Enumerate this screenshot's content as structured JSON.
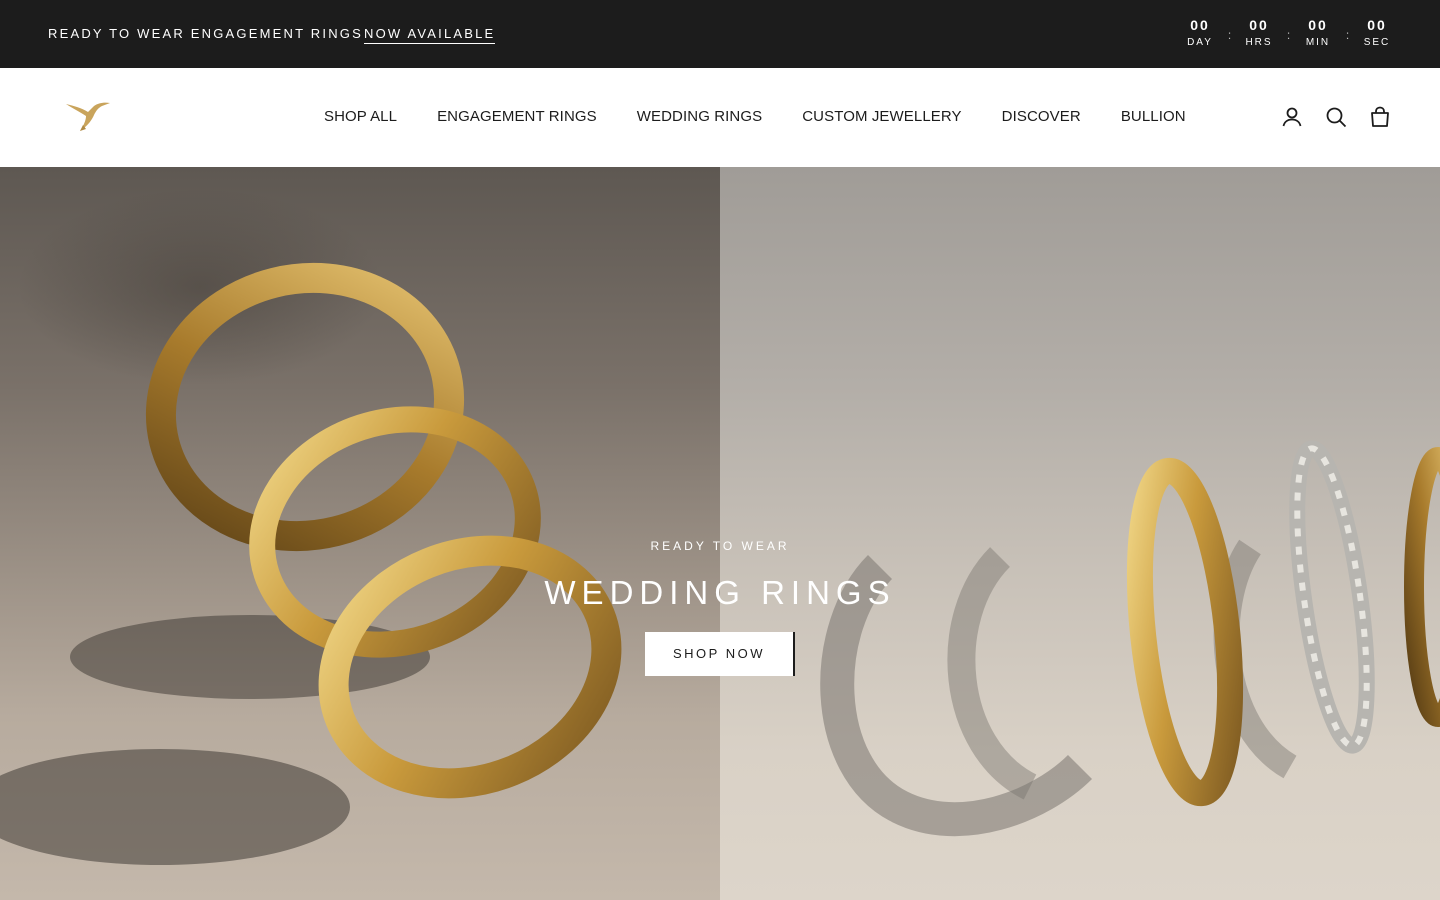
{
  "announcement": {
    "text": "READY TO WEAR ENGAGEMENT RINGS",
    "link_label": "NOW AVAILABLE",
    "countdown": [
      {
        "value": "00",
        "label": "DAY"
      },
      {
        "value": "00",
        "label": "HRS"
      },
      {
        "value": "00",
        "label": "MIN"
      },
      {
        "value": "00",
        "label": "SEC"
      }
    ],
    "separator": ":"
  },
  "header": {
    "nav": [
      {
        "label": "SHOP ALL"
      },
      {
        "label": "ENGAGEMENT RINGS"
      },
      {
        "label": "WEDDING RINGS"
      },
      {
        "label": "CUSTOM JEWELLERY"
      },
      {
        "label": "DISCOVER"
      },
      {
        "label": "BULLION"
      }
    ],
    "icons": [
      "account-icon",
      "search-icon",
      "cart-icon"
    ],
    "logo_color": "#c9a45c"
  },
  "hero": {
    "kicker": "READY TO WEAR",
    "title": "WEDDING RINGS",
    "button_label": "SHOP NOW"
  },
  "colors": {
    "announcement_bg": "#1c1c1c",
    "text": "#1c1c1c",
    "gold": "#c9a45c"
  }
}
